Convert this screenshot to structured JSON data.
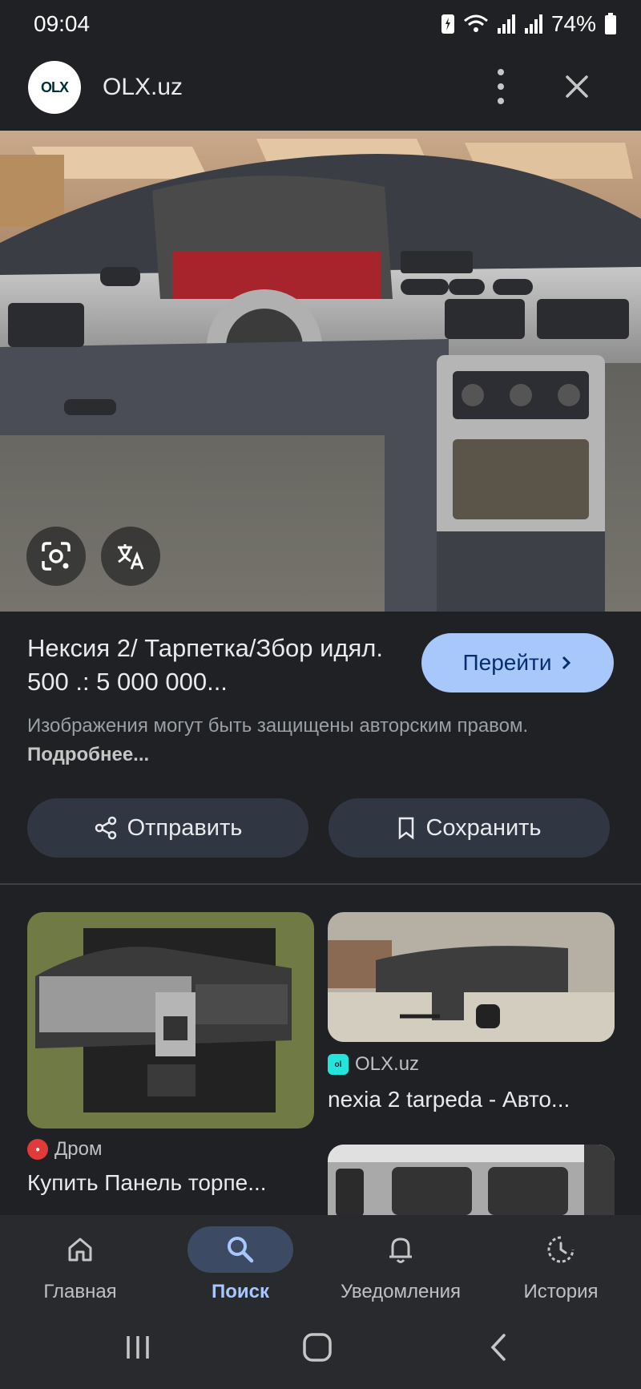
{
  "status_bar": {
    "time": "09:04",
    "battery": "74%"
  },
  "header": {
    "site_name": "OLX.uz",
    "logo_text": "OLX"
  },
  "result": {
    "title": "Нексия 2/ Тарпетка/Збор идял. 500 .: 5 000 000...",
    "visit_label": "Перейти",
    "copyright_text": "Изображения могут быть защищены авторским правом.",
    "more_link": "Подробнее..."
  },
  "actions": {
    "share_label": "Отправить",
    "save_label": "Сохранить"
  },
  "related": [
    {
      "source": "Дром",
      "title": "Купить Панель торпе..."
    },
    {
      "source": "OLX.uz",
      "title": "nexia 2 tarpeda - Авто..."
    }
  ],
  "bottom_nav": {
    "items": [
      {
        "label": "Главная",
        "icon": "home-icon"
      },
      {
        "label": "Поиск",
        "icon": "search-icon",
        "active": true
      },
      {
        "label": "Уведомления",
        "icon": "bell-icon"
      },
      {
        "label": "История",
        "icon": "history-icon"
      }
    ]
  },
  "colors": {
    "accent": "#a8c7fa",
    "background": "#1f2124",
    "button": "#303642"
  }
}
